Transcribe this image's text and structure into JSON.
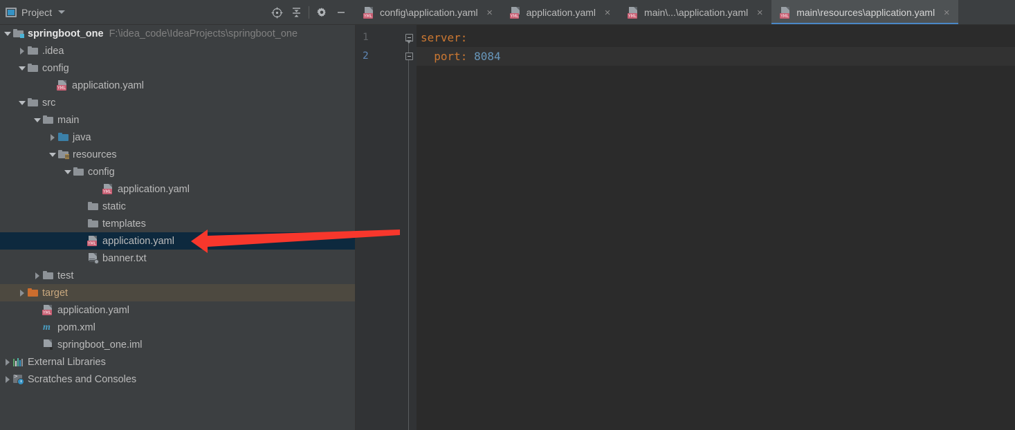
{
  "window": {
    "tool_window_title": "Project",
    "toolbar_buttons": [
      {
        "name": "locate-icon",
        "tooltip": "Select Opened File"
      },
      {
        "name": "collapse-all-icon",
        "tooltip": "Collapse All"
      },
      {
        "name": "gear-icon",
        "tooltip": "Settings"
      },
      {
        "name": "minimize-icon",
        "tooltip": "Hide"
      }
    ]
  },
  "tabs": [
    {
      "label": "config\\application.yaml",
      "icon": "yml-icon",
      "active": false,
      "close": "×"
    },
    {
      "label": "application.yaml",
      "icon": "yml-icon",
      "active": false,
      "close": "×"
    },
    {
      "label": "main\\...\\application.yaml",
      "icon": "yml-icon",
      "active": false,
      "close": "×"
    },
    {
      "label": "main\\resources\\application.yaml",
      "icon": "yml-icon",
      "active": true,
      "close": "×"
    }
  ],
  "tree": [
    {
      "label": "springboot_one",
      "sublabel": "F:\\idea_code\\IdeaProjects\\springboot_one",
      "indent": 0,
      "twisty": "expanded",
      "icon": "project-folder-icon",
      "style": "bold",
      "state": "normal"
    },
    {
      "label": ".idea",
      "sublabel": "",
      "indent": 1,
      "twisty": "collapsed",
      "icon": "folder-icon",
      "style": "normal",
      "state": "normal"
    },
    {
      "label": "config",
      "sublabel": "",
      "indent": 1,
      "twisty": "expanded",
      "icon": "folder-icon",
      "style": "normal",
      "state": "normal"
    },
    {
      "label": "application.yaml",
      "sublabel": "",
      "indent": 3,
      "twisty": "none",
      "icon": "yml-file-icon",
      "style": "normal",
      "state": "normal"
    },
    {
      "label": "src",
      "sublabel": "",
      "indent": 1,
      "twisty": "expanded",
      "icon": "folder-icon",
      "style": "normal",
      "state": "normal"
    },
    {
      "label": "main",
      "sublabel": "",
      "indent": 2,
      "twisty": "expanded",
      "icon": "folder-icon",
      "style": "normal",
      "state": "normal"
    },
    {
      "label": "java",
      "sublabel": "",
      "indent": 3,
      "twisty": "collapsed",
      "icon": "source-folder-icon",
      "style": "normal",
      "state": "normal"
    },
    {
      "label": "resources",
      "sublabel": "",
      "indent": 3,
      "twisty": "expanded",
      "icon": "resources-folder-icon",
      "style": "normal",
      "state": "normal"
    },
    {
      "label": "config",
      "sublabel": "",
      "indent": 4,
      "twisty": "expanded",
      "icon": "folder-icon",
      "style": "normal",
      "state": "normal"
    },
    {
      "label": "application.yaml",
      "sublabel": "",
      "indent": 6,
      "twisty": "none",
      "icon": "yml-file-icon",
      "style": "normal",
      "state": "normal"
    },
    {
      "label": "static",
      "sublabel": "",
      "indent": 5,
      "twisty": "none",
      "icon": "folder-icon",
      "style": "normal",
      "state": "normal"
    },
    {
      "label": "templates",
      "sublabel": "",
      "indent": 5,
      "twisty": "none",
      "icon": "folder-icon",
      "style": "normal",
      "state": "normal"
    },
    {
      "label": "application.yaml",
      "sublabel": "",
      "indent": 5,
      "twisty": "none",
      "icon": "yml-file-icon",
      "style": "normal",
      "state": "selected"
    },
    {
      "label": "banner.txt",
      "sublabel": "",
      "indent": 5,
      "twisty": "none",
      "icon": "text-file-icon",
      "style": "normal",
      "state": "normal"
    },
    {
      "label": "test",
      "sublabel": "",
      "indent": 2,
      "twisty": "collapsed",
      "icon": "folder-icon",
      "style": "normal",
      "state": "normal"
    },
    {
      "label": "target",
      "sublabel": "",
      "indent": 1,
      "twisty": "collapsed",
      "icon": "excluded-folder-icon",
      "style": "excluded",
      "state": "hover"
    },
    {
      "label": "application.yaml",
      "sublabel": "",
      "indent": 2,
      "twisty": "none",
      "icon": "yml-file-icon",
      "style": "normal",
      "state": "normal"
    },
    {
      "label": "pom.xml",
      "sublabel": "",
      "indent": 2,
      "twisty": "none",
      "icon": "maven-icon",
      "style": "normal",
      "state": "normal"
    },
    {
      "label": "springboot_one.iml",
      "sublabel": "",
      "indent": 2,
      "twisty": "none",
      "icon": "iml-file-icon",
      "style": "normal",
      "state": "normal"
    },
    {
      "label": "External Libraries",
      "sublabel": "",
      "indent": 0,
      "twisty": "collapsed",
      "icon": "libraries-icon",
      "style": "normal",
      "state": "normal"
    },
    {
      "label": "Scratches and Consoles",
      "sublabel": "",
      "indent": 0,
      "twisty": "collapsed",
      "icon": "scratches-icon",
      "style": "normal",
      "state": "normal"
    }
  ],
  "editor": {
    "lines": [
      {
        "number": "1",
        "current": false,
        "fold": "top",
        "tokens": [
          {
            "text": "server",
            "type": "key"
          },
          {
            "text": ":",
            "type": "punct"
          }
        ]
      },
      {
        "number": "2",
        "current": true,
        "fold": "bottom",
        "tokens": [
          {
            "text": "  port",
            "type": "key"
          },
          {
            "text": ": ",
            "type": "punct"
          },
          {
            "text": "8084",
            "type": "value"
          }
        ]
      }
    ]
  },
  "annotation": {
    "type": "red-arrow",
    "color": "#f8372c",
    "points_to": "application.yaml",
    "direction": "left"
  },
  "colors": {
    "panel_bg": "#3c3f41",
    "editor_bg": "#2b2b2b",
    "gutter_bg": "#313335",
    "selection_bg": "#0d293e",
    "active_tab_bg": "#4e5254",
    "accent_blue": "#4a88c7",
    "key_orange": "#cc7832",
    "value_blue": "#6897bb",
    "excluded_orange": "#cc6d2e",
    "arrow_red": "#f8372c"
  }
}
